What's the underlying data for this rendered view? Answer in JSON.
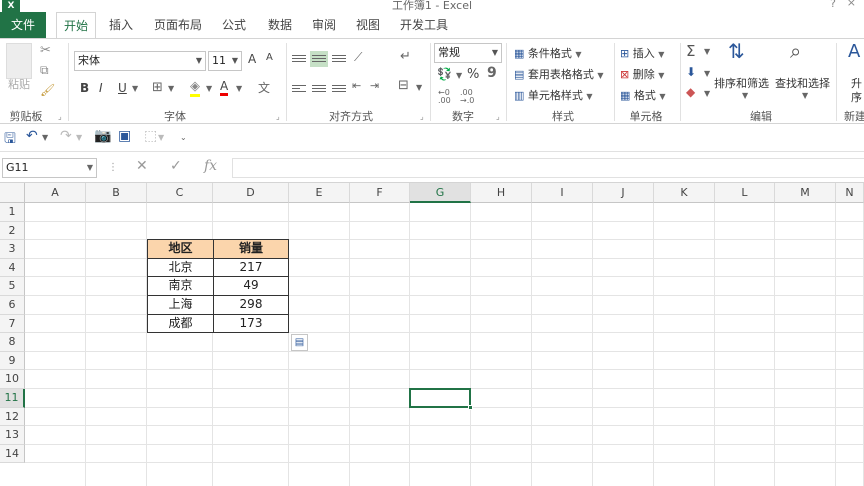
{
  "window": {
    "title": "工作簿1 - Excel",
    "help": "?",
    "close": "×",
    "logo": "X"
  },
  "tabs": [
    {
      "label": "文件"
    },
    {
      "label": "开始"
    },
    {
      "label": "插入"
    },
    {
      "label": "页面布局"
    },
    {
      "label": "公式"
    },
    {
      "label": "数据"
    },
    {
      "label": "审阅"
    },
    {
      "label": "视图"
    },
    {
      "label": "开发工具"
    }
  ],
  "ribbon": {
    "clipboard": {
      "paste_label": "粘贴",
      "group_label": "剪贴板"
    },
    "font": {
      "name": "宋体",
      "size": "11",
      "bold": "B",
      "italic": "I",
      "underline": "U",
      "grow": "A",
      "shrink": "A",
      "wen": "文",
      "fontcolor": "A",
      "group_label": "字体"
    },
    "alignment": {
      "group_label": "对齐方式"
    },
    "number": {
      "format": "常规",
      "percent": "%",
      "comma": "9",
      "group_label": "数字"
    },
    "styles": {
      "cond": "条件格式",
      "table": "套用表格格式",
      "cell": "单元格样式",
      "group_label": "样式"
    },
    "cells": {
      "insert": "插入",
      "delete": "删除",
      "format": "格式",
      "group_label": "单元格"
    },
    "editing": {
      "sum": "Σ",
      "sort": "排序和筛选",
      "find": "查找和选择",
      "group_label": "编辑"
    },
    "new_group": {
      "label1": "升",
      "label2": "序",
      "group_label": "新建"
    }
  },
  "namebox": "G11",
  "fx": "fx",
  "columns": [
    "A",
    "B",
    "C",
    "D",
    "E",
    "F",
    "G",
    "H",
    "I",
    "J",
    "K",
    "L",
    "M",
    "N"
  ],
  "rows": [
    "1",
    "2",
    "3",
    "4",
    "5",
    "6",
    "7",
    "8",
    "9",
    "10",
    "11",
    "12",
    "13",
    "14"
  ],
  "table": {
    "headers": [
      "地区",
      "销量"
    ],
    "rows": [
      [
        "北京",
        "217"
      ],
      [
        "南京",
        "49"
      ],
      [
        "上海",
        "298"
      ],
      [
        "成都",
        "173"
      ]
    ]
  },
  "colors": {
    "accent": "#217346",
    "header_fill": "#fbd5ac"
  }
}
